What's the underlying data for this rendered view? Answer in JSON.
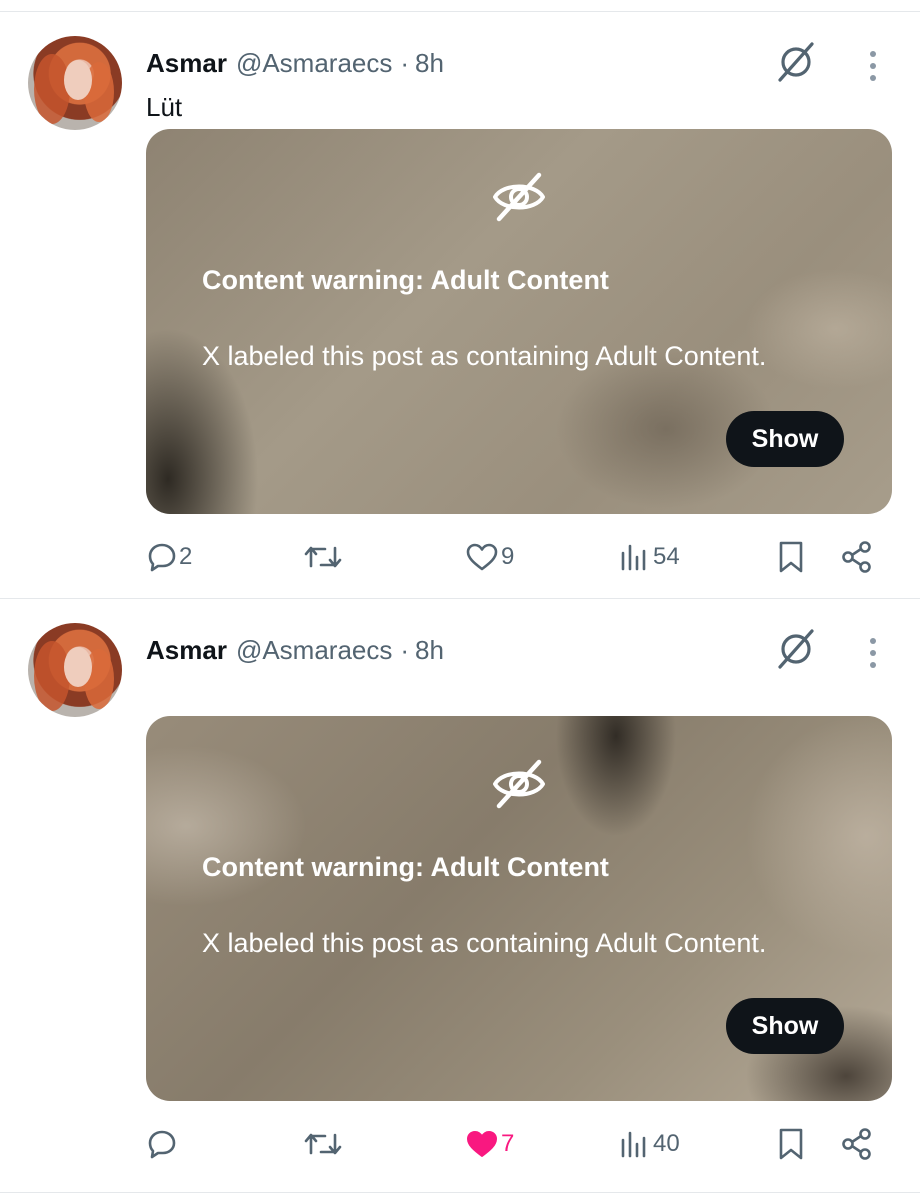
{
  "colors": {
    "text_primary": "#0f1419",
    "text_secondary": "#536471",
    "like_active": "#f91880",
    "divider": "#e5e8eb",
    "show_button_bg": "#0f1419"
  },
  "posts": [
    {
      "author_name": "Asmar",
      "handle": "@Asmaraecs",
      "separator": "·",
      "time": "8h",
      "text": "Lüt",
      "warning_title": "Content warning: Adult Content",
      "warning_body": "X labeled this post as containing Adult Content.",
      "show_label": "Show",
      "replies": "2",
      "reposts": "",
      "likes": "9",
      "liked": false,
      "views": "54",
      "icons": [
        "grok-icon",
        "more-icon",
        "eye-slash-icon",
        "reply-icon",
        "repost-icon",
        "like-icon",
        "views-icon",
        "bookmark-icon",
        "share-icon"
      ]
    },
    {
      "author_name": "Asmar",
      "handle": "@Asmaraecs",
      "separator": "·",
      "time": "8h",
      "text": "",
      "warning_title": "Content warning: Adult Content",
      "warning_body": "X labeled this post as containing Adult Content.",
      "show_label": "Show",
      "replies": "",
      "reposts": "",
      "likes": "7",
      "liked": true,
      "views": "40",
      "icons": [
        "grok-icon",
        "more-icon",
        "eye-slash-icon",
        "reply-icon",
        "repost-icon",
        "like-filled-icon",
        "views-icon",
        "bookmark-icon",
        "share-icon"
      ]
    }
  ]
}
